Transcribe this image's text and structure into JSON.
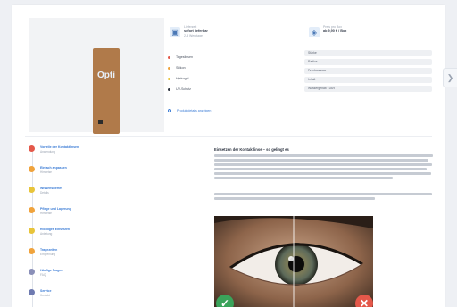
{
  "product": {
    "box_logo": "Opti"
  },
  "info_blocks": [
    {
      "small": "Lieferzeit",
      "main": "sofort lieferbar",
      "sub": "2-3 Werktage",
      "icon": "truck-icon"
    },
    {
      "small": "Preis pro Box",
      "main": "ab 9,90 € / Box",
      "sub": "",
      "icon": "tag-icon"
    }
  ],
  "features": [
    {
      "label": "Tageslinsen",
      "color": "#e4584a"
    },
    {
      "label": "Silikon",
      "color": "#f0a33c"
    },
    {
      "label": "Hydrogel",
      "color": "#e8c43a"
    },
    {
      "label": "UV-Schutz",
      "color": "#2f3440"
    }
  ],
  "specs": [
    "Stärke",
    "Radius",
    "Durchmesser",
    "Inhalt",
    "Wassergehalt · Dk/t"
  ],
  "more_link": "Produktdetails anzeigen",
  "timeline": [
    {
      "title": "Vorteile der Kontaktlinsen",
      "sub": "Anwendung",
      "color": "#e4584a"
    },
    {
      "title": "Einfach anpassen",
      "sub": "Hinweise",
      "color": "#f0a33c"
    },
    {
      "title": "Wissenswertes",
      "sub": "Details",
      "color": "#e8c43a"
    },
    {
      "title": "Pflege und Lagerung",
      "sub": "Hinweise",
      "color": "#f0a33c"
    },
    {
      "title": "Richtiges Einsetzen",
      "sub": "Anleitung",
      "color": "#e8c43a"
    },
    {
      "title": "Tragezeiten",
      "sub": "Empfehlung",
      "color": "#f0a33c"
    },
    {
      "title": "Häufige Fragen",
      "sub": "FAQ",
      "color": "#8a8fb8"
    },
    {
      "title": "Service",
      "sub": "Kontakt",
      "color": "#6e7ab0"
    }
  ],
  "article": {
    "title": "Einsetzen der Kontaktlinse – so gelingt es",
    "eye_alt": "eye-photo-correct-vs-incorrect"
  },
  "badges": {
    "ok_icon": "checkmark-icon",
    "bad_icon": "cross-icon",
    "ok_color": "#3aa35a",
    "bad_color": "#e4584a"
  }
}
